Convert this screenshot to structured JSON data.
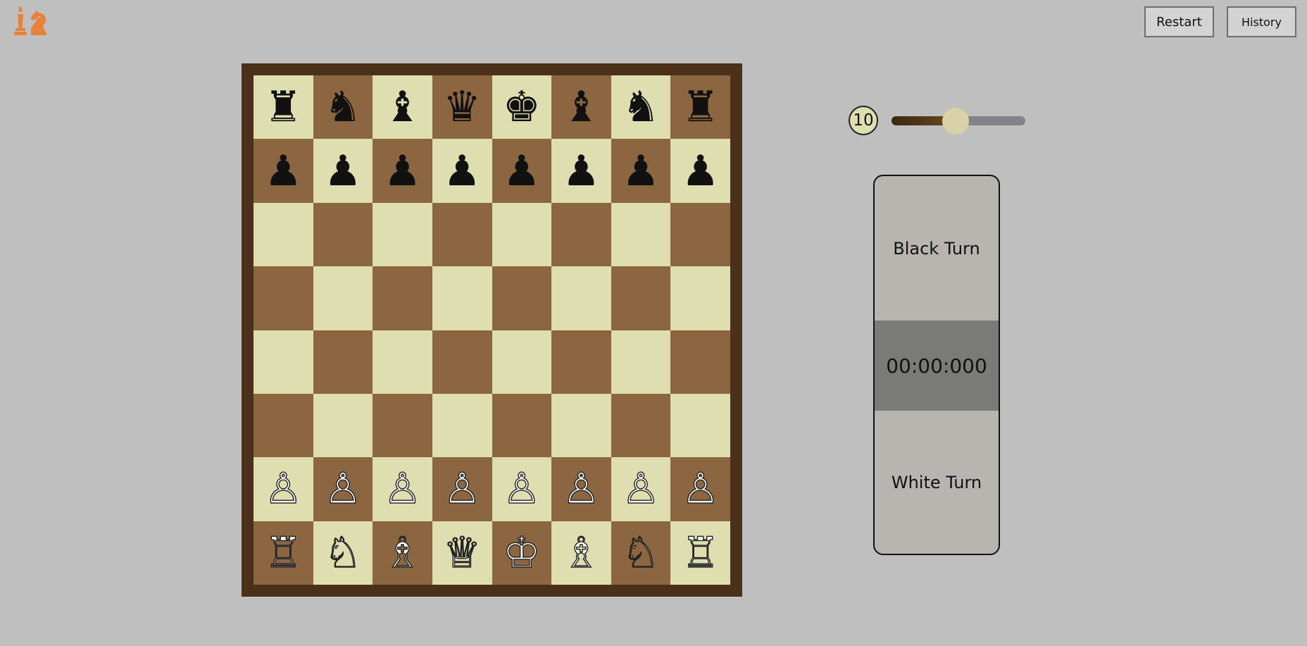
{
  "header": {
    "logo_icon": "chess-pieces-logo-icon",
    "restart_label": "Restart",
    "history_label": "History"
  },
  "colors": {
    "background": "#bfbfbf",
    "board_frame": "#4b301a",
    "light_square": "#dedeb0",
    "dark_square": "#8b6640",
    "logo": "#e8823a",
    "timer_bg": "#7a7b77",
    "panel_bg": "#b8b5b1"
  },
  "board": {
    "rows": [
      [
        "♜",
        "♞",
        "♝",
        "♛",
        "♚",
        "♝",
        "♞",
        "♜"
      ],
      [
        "♟",
        "♟",
        "♟",
        "♟",
        "♟",
        "♟",
        "♟",
        "♟"
      ],
      [
        "",
        "",
        "",
        "",
        "",
        "",
        "",
        ""
      ],
      [
        "",
        "",
        "",
        "",
        "",
        "",
        "",
        ""
      ],
      [
        "",
        "",
        "",
        "",
        "",
        "",
        "",
        ""
      ],
      [
        "",
        "",
        "",
        "",
        "",
        "",
        "",
        ""
      ],
      [
        "♙",
        "♙",
        "♙",
        "♙",
        "♙",
        "♙",
        "♙",
        "♙"
      ],
      [
        "♖",
        "♘",
        "♗",
        "♕",
        "♔",
        "♗",
        "♘",
        "♖"
      ]
    ],
    "piece_names": [
      [
        "black-rook",
        "black-knight",
        "black-bishop",
        "black-queen",
        "black-king",
        "black-bishop",
        "black-knight",
        "black-rook"
      ],
      [
        "black-pawn",
        "black-pawn",
        "black-pawn",
        "black-pawn",
        "black-pawn",
        "black-pawn",
        "black-pawn",
        "black-pawn"
      ],
      [
        "",
        "",
        "",
        "",
        "",
        "",
        "",
        ""
      ],
      [
        "",
        "",
        "",
        "",
        "",
        "",
        "",
        ""
      ],
      [
        "",
        "",
        "",
        "",
        "",
        "",
        "",
        ""
      ],
      [
        "",
        "",
        "",
        "",
        "",
        "",
        "",
        ""
      ],
      [
        "white-pawn",
        "white-pawn",
        "white-pawn",
        "white-pawn",
        "white-pawn",
        "white-pawn",
        "white-pawn",
        "white-pawn"
      ],
      [
        "white-rook",
        "white-knight",
        "white-bishop",
        "white-queen",
        "white-king",
        "white-bishop",
        "white-knight",
        "white-rook"
      ]
    ]
  },
  "difficulty": {
    "value_label": "10",
    "slider_fraction": 0.48
  },
  "turn_panel": {
    "black_label": "Black Turn",
    "timer": "00:00:000",
    "white_label": "White Turn"
  }
}
